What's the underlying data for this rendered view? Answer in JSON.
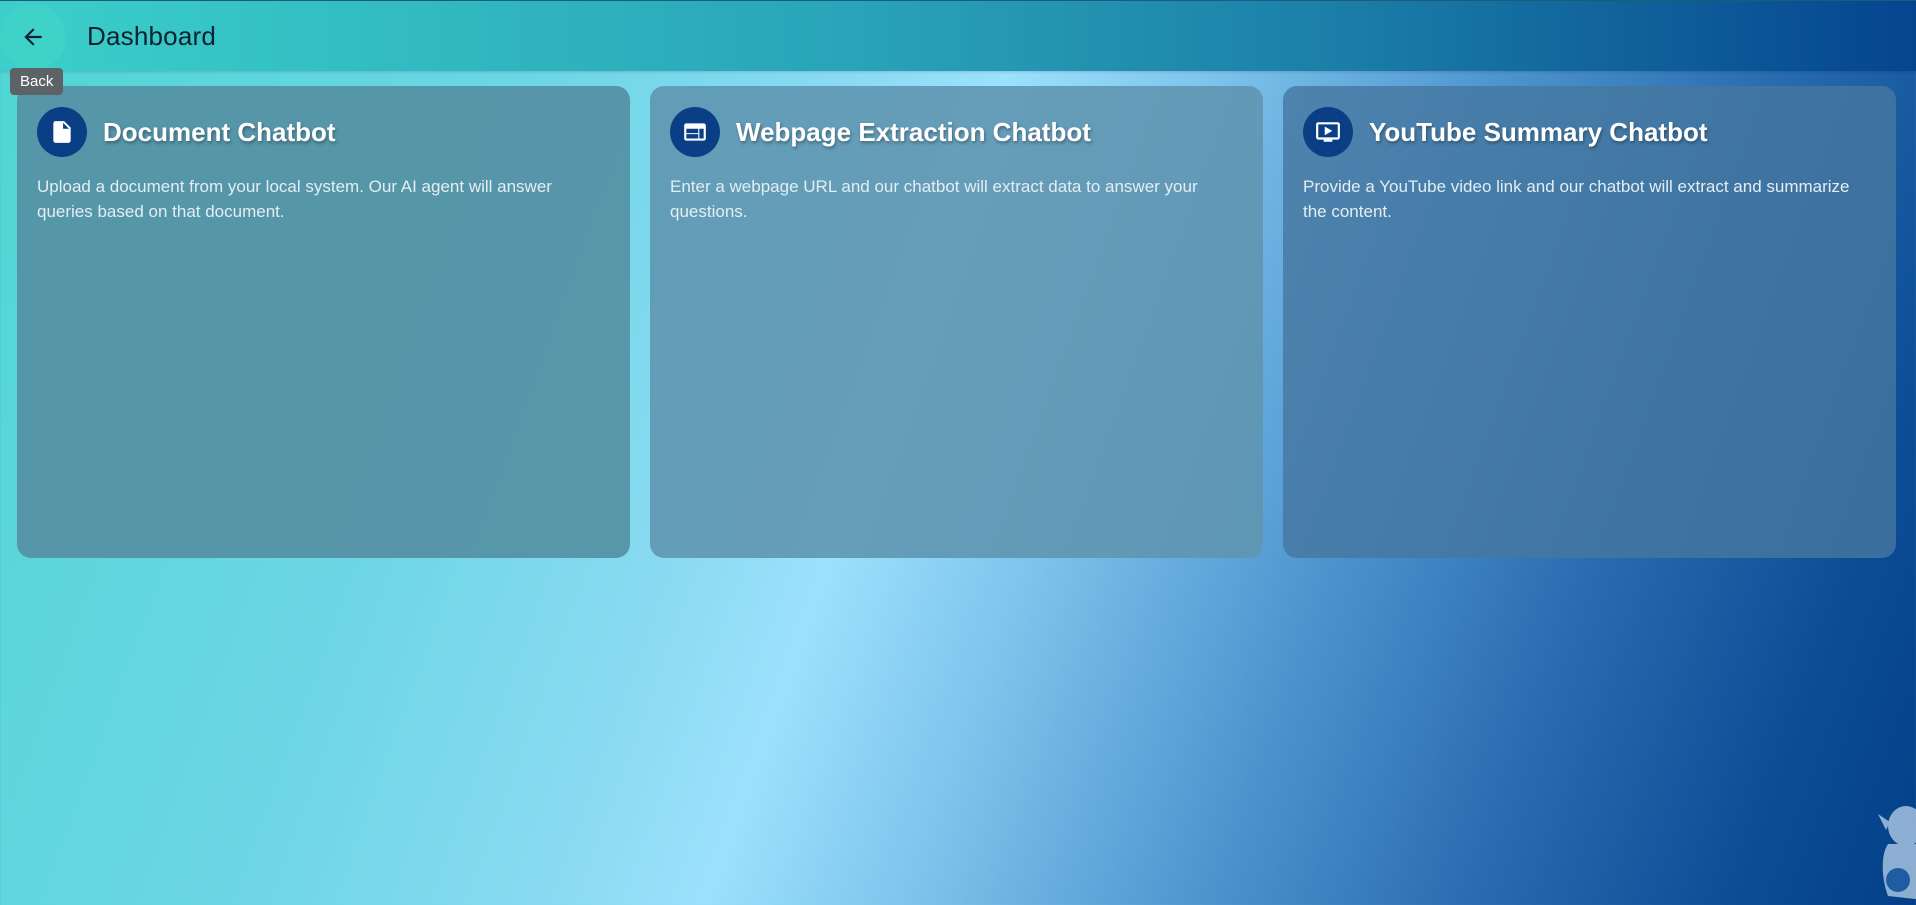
{
  "appbar": {
    "title": "Dashboard",
    "back_tooltip": "Back",
    "back_icon": "arrow-left-icon"
  },
  "cards": [
    {
      "title": "Document Chatbot",
      "description": "Upload a document from your local system. Our AI agent will answer queries based on that document.",
      "icon": "document-icon"
    },
    {
      "title": "Webpage Extraction Chatbot",
      "description": "Enter a webpage URL and our chatbot will extract data to answer your questions.",
      "icon": "webpage-icon"
    },
    {
      "title": "YouTube Summary Chatbot",
      "description": "Provide a YouTube video link and our chatbot will extract and summarize the content.",
      "icon": "video-screen-icon"
    }
  ],
  "colors": {
    "icon_circle": "#0a3f85",
    "appbar_start": "#3ccfca",
    "appbar_end": "#044590"
  }
}
